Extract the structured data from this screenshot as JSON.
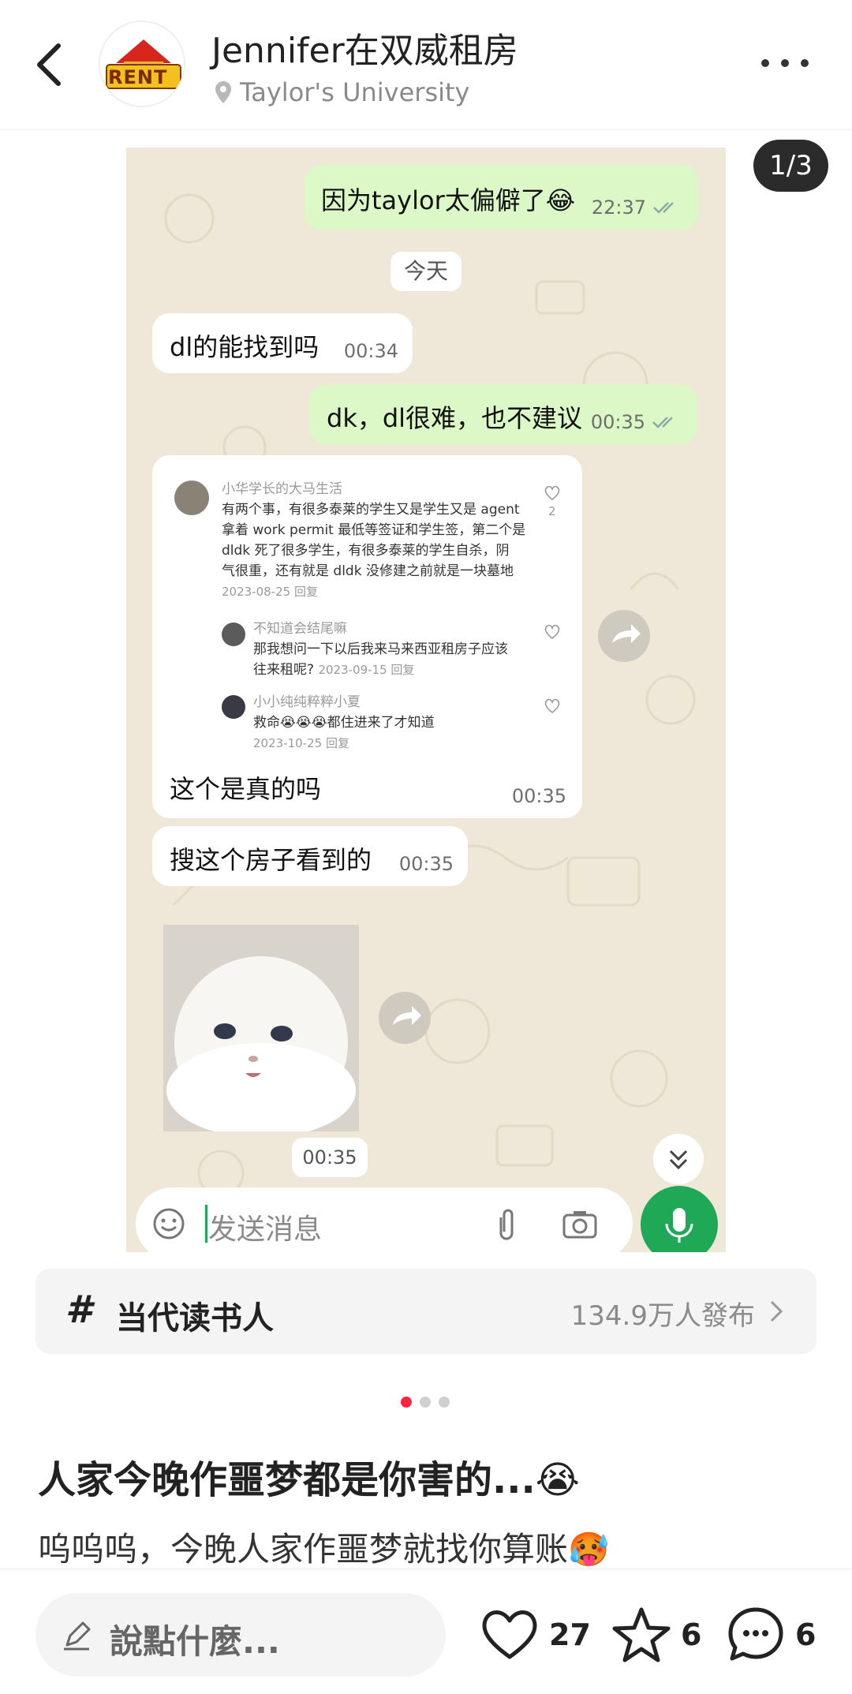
{
  "header": {
    "author_name": "Jennifer在双威租房",
    "location": "Taylor's University",
    "avatar_text": "RENT"
  },
  "carousel": {
    "page_counter": "1/3",
    "current_index": 1,
    "total": 3,
    "chat": {
      "messages": [
        {
          "dir": "out",
          "text": "因为taylor太偏僻了😂",
          "time": "22:37"
        },
        {
          "dir": "date",
          "text": "今天"
        },
        {
          "dir": "in",
          "text": "dl的能找到吗",
          "time": "00:34"
        },
        {
          "dir": "out",
          "text": "dk，dl很难，也不建议",
          "time": "00:35"
        },
        {
          "dir": "in",
          "text": "这个是真的吗",
          "time": "00:35"
        },
        {
          "dir": "in",
          "text": "搜这个房子看到的",
          "time": "00:35"
        },
        {
          "dir": "in-image",
          "time": "00:35"
        }
      ],
      "embedded_comments": [
        {
          "name": "小华学长的大马生活",
          "text1": "有两个事，有很多泰莱的学生又是学生又是 agent",
          "text2": "拿着 work permit 最低等签证和学生签，第二个是",
          "text3": "dldk 死了很多学生，有很多泰莱的学生自杀，阴",
          "text4": "气很重，还有就是 dldk 没修建之前就是一块墓地",
          "meta": "2023-08-25 回复",
          "likes": "2"
        },
        {
          "name": "不知道会结尾嘛",
          "text1": "那我想问一下以后我来马来西亚租房子应该",
          "text2": "往来租呢?",
          "meta": "2023-09-15 回复"
        },
        {
          "name": "小小纯纯粹粹小夏",
          "text1": "救命😭😭😭都住进来了才知道",
          "meta": "2023-10-25 回复"
        }
      ],
      "input_placeholder": "发送消息"
    }
  },
  "topic": {
    "hash": "#",
    "name": "当代读书人",
    "count": "134.9万人發布"
  },
  "post": {
    "title": "人家今晚作噩梦都是你害的...😭",
    "body": "呜呜呜，今晚人家作噩梦就找你算账🥵"
  },
  "bottom": {
    "comment_placeholder": "說點什麼...",
    "likes": "27",
    "collects": "6",
    "comments": "6"
  },
  "colors": {
    "accent": "#ff2442",
    "chat_bg": "#efe8d8",
    "out_bubble": "#dcf8c6",
    "mic_green": "#1fa855"
  }
}
